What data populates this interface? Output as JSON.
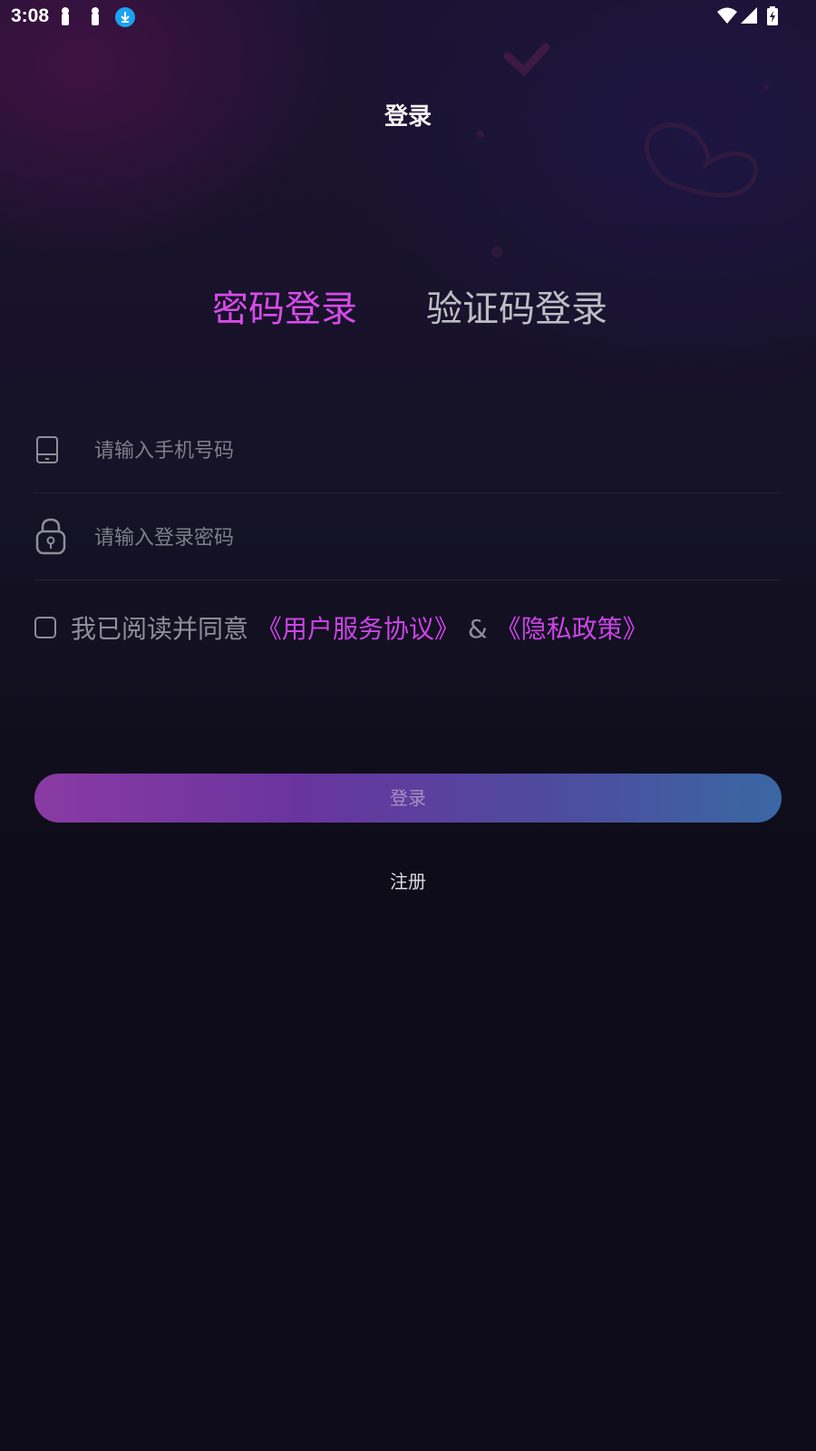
{
  "status_bar": {
    "time": "3:08"
  },
  "header": {
    "title": "登录"
  },
  "tabs": [
    {
      "label": "密码登录",
      "active": true
    },
    {
      "label": "验证码登录",
      "active": false
    }
  ],
  "form": {
    "phone_placeholder": "请输入手机号码",
    "phone_value": "",
    "password_placeholder": "请输入登录密码",
    "password_value": ""
  },
  "agreement": {
    "prefix": "我已阅读并同意",
    "terms_link": "《用户服务协议》",
    "amp": "&",
    "privacy_link": "《隐私政策》",
    "checked": false
  },
  "login_button": "登录",
  "register_link": "注册",
  "colors": {
    "accent": "#d64be8",
    "background": "#0e0c18",
    "button_gradient_start": "#8a3aa3",
    "button_gradient_end": "#3a67a3"
  }
}
